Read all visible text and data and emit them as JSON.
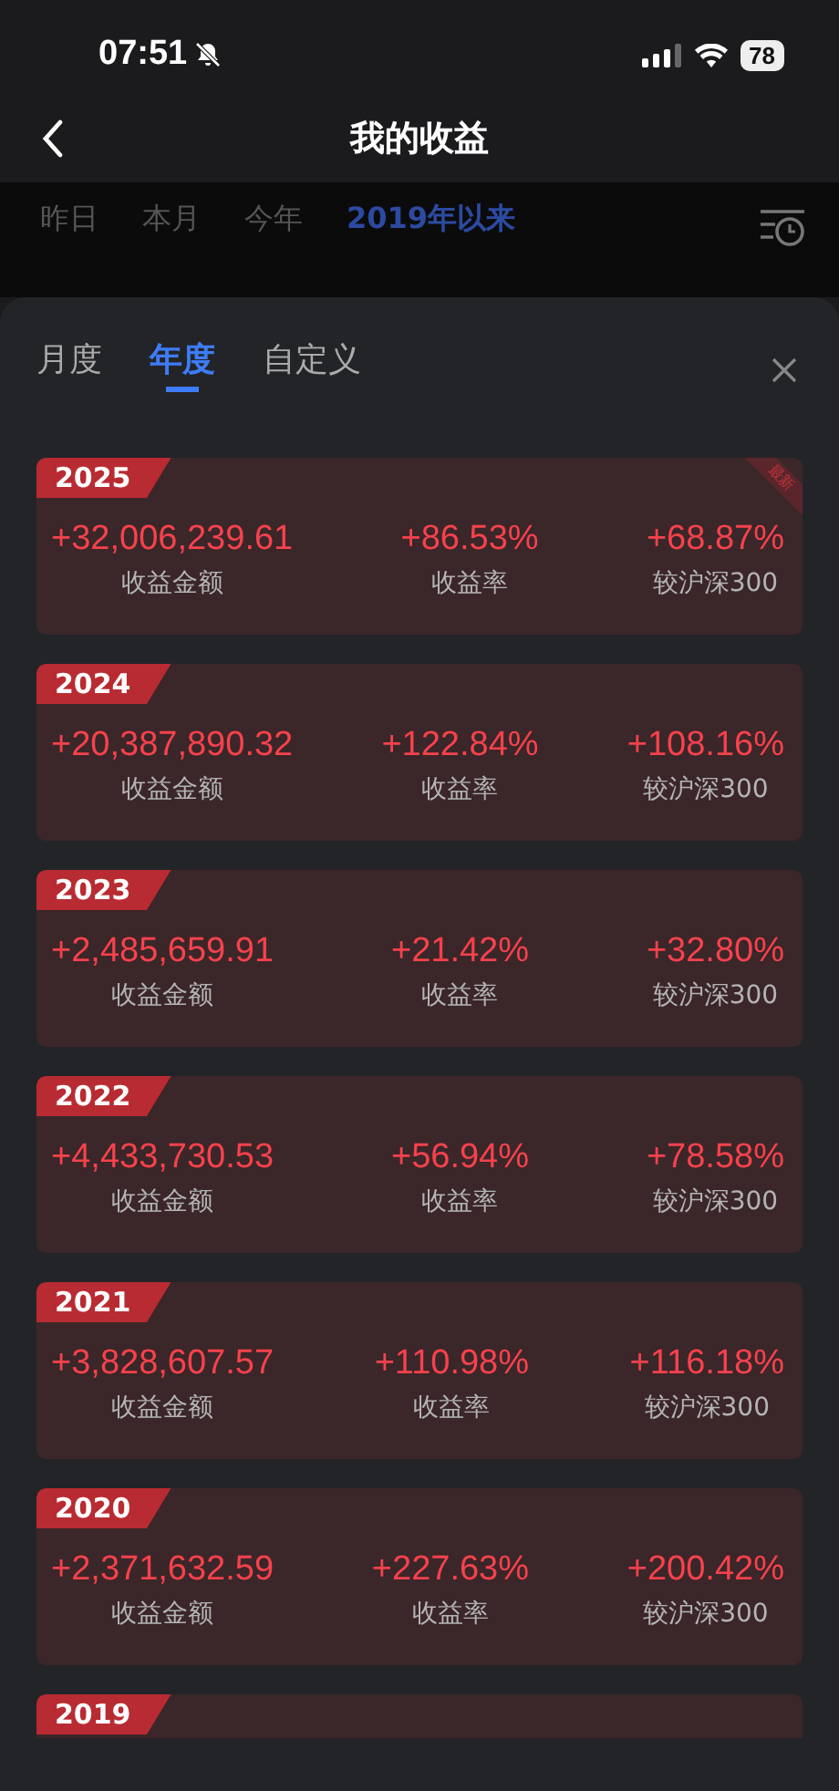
{
  "status_bar": {
    "time": "07:51",
    "battery": "78"
  },
  "nav": {
    "title": "我的收益"
  },
  "period_tabs": [
    {
      "label": "昨日",
      "selected": false
    },
    {
      "label": "本月",
      "selected": false
    },
    {
      "label": "今年",
      "selected": false
    },
    {
      "label": "2019年以来",
      "selected": true
    }
  ],
  "sheet": {
    "tabs": [
      {
        "label": "月度",
        "selected": false
      },
      {
        "label": "年度",
        "selected": true
      },
      {
        "label": "自定义",
        "selected": false
      }
    ],
    "cards": [
      {
        "year": "2025",
        "ribbon": "最新",
        "amount": "+32,006,239.61",
        "amount_label": "收益金额",
        "rate": "+86.53%",
        "rate_label": "收益率",
        "vs": "+68.87%",
        "vs_label": "较沪深300"
      },
      {
        "year": "2024",
        "amount": "+20,387,890.32",
        "amount_label": "收益金额",
        "rate": "+122.84%",
        "rate_label": "收益率",
        "vs": "+108.16%",
        "vs_label": "较沪深300"
      },
      {
        "year": "2023",
        "amount": "+2,485,659.91",
        "amount_label": "收益金额",
        "rate": "+21.42%",
        "rate_label": "收益率",
        "vs": "+32.80%",
        "vs_label": "较沪深300"
      },
      {
        "year": "2022",
        "amount": "+4,433,730.53",
        "amount_label": "收益金额",
        "rate": "+56.94%",
        "rate_label": "收益率",
        "vs": "+78.58%",
        "vs_label": "较沪深300"
      },
      {
        "year": "2021",
        "amount": "+3,828,607.57",
        "amount_label": "收益金额",
        "rate": "+110.98%",
        "rate_label": "收益率",
        "vs": "+116.18%",
        "vs_label": "较沪深300"
      },
      {
        "year": "2020",
        "amount": "+2,371,632.59",
        "amount_label": "收益金额",
        "rate": "+227.63%",
        "rate_label": "收益率",
        "vs": "+200.42%",
        "vs_label": "较沪深300"
      },
      {
        "year": "2019"
      }
    ]
  }
}
